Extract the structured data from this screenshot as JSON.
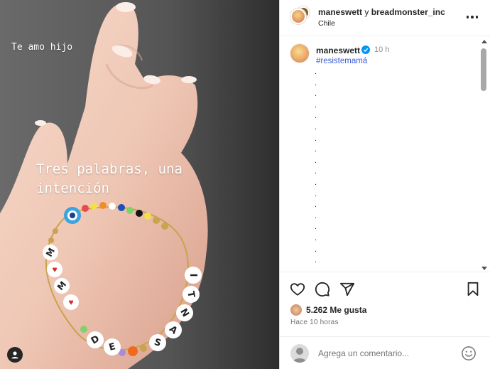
{
  "story": {
    "top_text": "Te amo hijo",
    "main_text": "Tres palabras, una\nintención",
    "bracelet_letters": [
      "M",
      "♥",
      "M",
      "♥",
      "D",
      "E",
      "S",
      "A",
      "N",
      "T",
      "I"
    ]
  },
  "header": {
    "user1": "maneswett",
    "joiner": "y",
    "user2": "breadmonster_inc",
    "location": "Chile"
  },
  "caption": {
    "username": "maneswett",
    "time": "10 h",
    "hashtag": "#resistemamá",
    "dots": [
      ".",
      ".",
      ".",
      ".",
      ".",
      ".",
      ".",
      ".",
      ".",
      ".",
      ".",
      ".",
      ".",
      ".",
      ".",
      ".",
      ".",
      "."
    ]
  },
  "engagement": {
    "likes": "5.262 Me gusta",
    "time_ago": "Hace 10 horas"
  },
  "comment": {
    "placeholder": "Agrega un comentario..."
  },
  "icons": {
    "like": "heart-icon",
    "comment": "comment-icon",
    "share": "share-icon",
    "save": "bookmark-icon",
    "more": "more-icon",
    "emoji": "emoji-icon",
    "tagged_user": "user-tag-icon"
  },
  "colors": {
    "verified": "#0095f6",
    "hashtag": "#3b5bdb"
  }
}
